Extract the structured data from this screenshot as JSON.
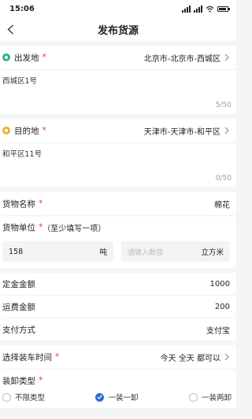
{
  "status_bar": {
    "time": "15:06",
    "battery_level": 0.85
  },
  "nav": {
    "title": "发布货源"
  },
  "origin": {
    "label": "出发地",
    "required": "*",
    "city": "北京市-北京市-西城区",
    "address": "西城区1号",
    "counter": "5/50",
    "dot_color": "#35b27a"
  },
  "destination": {
    "label": "目的地",
    "required": "*",
    "city": "天津市-天津市-和平区",
    "address": "和平区11号",
    "counter": "0/50",
    "dot_color": "#e8b52c"
  },
  "cargo": {
    "name_label": "货物名称",
    "name_required": "*",
    "name_value": "棉花",
    "unit_label": "货物单位",
    "unit_required": "*",
    "unit_hint": "（至少填写一项）",
    "weight_value": "158",
    "weight_unit": "吨",
    "volume_placeholder": "请输入数值",
    "volume_unit": "立方米"
  },
  "payment": {
    "deposit_label": "定金金额",
    "deposit_value": "1000",
    "freight_label": "运费金额",
    "freight_value": "200",
    "method_label": "支付方式",
    "method_value": "支付宝"
  },
  "loading": {
    "time_label": "选择装车时间",
    "time_required": "*",
    "time_value": "今天 全天 都可以",
    "type_label": "装卸类型",
    "type_required": "*",
    "options": [
      {
        "label": "不限类型",
        "checked": false
      },
      {
        "label": "一装一卸",
        "checked": true
      },
      {
        "label": "一装两卸",
        "checked": false
      }
    ]
  },
  "colors": {
    "accent": "#2f6bd8",
    "required": "#e23b3b"
  }
}
